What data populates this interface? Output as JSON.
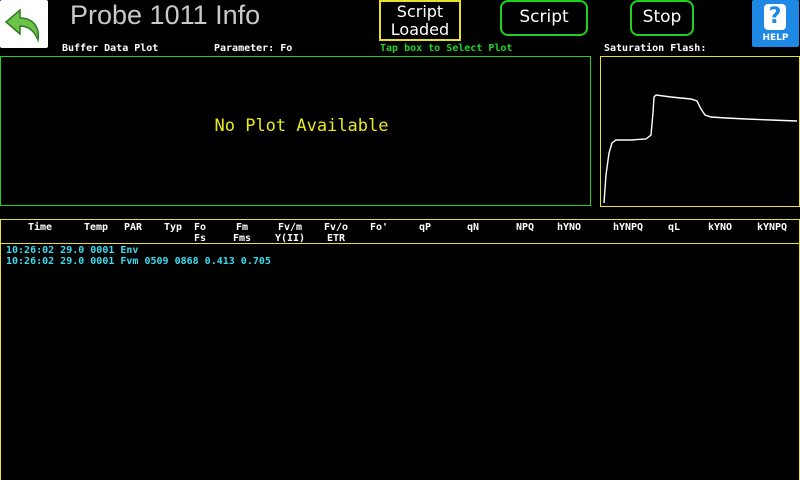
{
  "header": {
    "title": "Probe 1011 Info",
    "script_loaded_label": "Script Loaded",
    "script_button_label": "Script",
    "stop_button_label": "Stop",
    "help_label": "HELP"
  },
  "labels": {
    "buffer_data_plot": "Buffer Data Plot",
    "parameter": "Parameter: Fo",
    "tap_instruction": "Tap box to Select Plot",
    "saturation_flash": "Saturation Flash:"
  },
  "plot": {
    "message": "No Plot Available"
  },
  "table": {
    "columns": [
      {
        "line1": "",
        "line2": "Time"
      },
      {
        "line1": "",
        "line2": "Temp"
      },
      {
        "line1": "",
        "line2": "PAR"
      },
      {
        "line1": "",
        "line2": "Typ"
      },
      {
        "line1": "Fo",
        "line2": "Fs"
      },
      {
        "line1": "Fm",
        "line2": "Fms"
      },
      {
        "line1": "Fv/m",
        "line2": "Y(II)"
      },
      {
        "line1": "Fv/o",
        "line2": "ETR"
      },
      {
        "line1": "",
        "line2": "Fo'"
      },
      {
        "line1": "",
        "line2": "qP"
      },
      {
        "line1": "",
        "line2": "qN"
      },
      {
        "line1": "",
        "line2": "NPQ"
      },
      {
        "line1": "",
        "line2": "hYNO"
      },
      {
        "line1": "",
        "line2": "hYNPQ"
      },
      {
        "line1": "",
        "line2": "qL"
      },
      {
        "line1": "",
        "line2": "kYNO"
      },
      {
        "line1": "",
        "line2": "kYNPQ"
      }
    ],
    "rows": [
      "10:26:02 29.0 0001 Env",
      "10:26:02 29.0 0001 Fvm 0509 0868 0.413 0.705"
    ]
  },
  "colors": {
    "background": "#000000",
    "accent_green": "#1fd01f",
    "accent_yellow": "#e6e02a",
    "row_text": "#3bdcf0",
    "help_blue": "#1e88e5"
  },
  "icons": {
    "back": "back-arrow-icon",
    "help": "help-question-icon"
  }
}
